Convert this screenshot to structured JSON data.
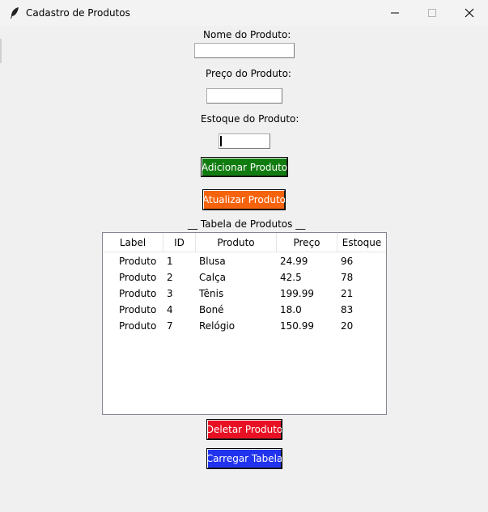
{
  "window": {
    "title": "Cadastro de Produtos"
  },
  "form": {
    "nome_label": "Nome do Produto:",
    "nome_value": "",
    "preco_label": "Preço do Produto:",
    "preco_value": "",
    "estoque_label": "Estoque do Produto:",
    "estoque_value": ""
  },
  "buttons": {
    "adicionar": "Adicionar Produto",
    "atualizar": "Atualizar Produto",
    "deletar": "Deletar Produto",
    "carregar": "Carregar Tabela"
  },
  "colors": {
    "adicionar": "#107c10",
    "atualizar": "#f7630c",
    "deletar": "#e81123",
    "carregar": "#2233ee"
  },
  "table": {
    "title": "__ Tabela de Produtos __",
    "columns": [
      "Label",
      "ID",
      "Produto",
      "Preço",
      "Estoque"
    ],
    "rows": [
      [
        "Produto",
        "1",
        "Blusa",
        "24.99",
        "96"
      ],
      [
        "Produto",
        "2",
        "Calça",
        "42.5",
        "78"
      ],
      [
        "Produto",
        "3",
        "Tênis",
        "199.99",
        "21"
      ],
      [
        "Produto",
        "4",
        "Boné",
        "18.0",
        "83"
      ],
      [
        "Produto",
        "7",
        "Relógio",
        "150.99",
        "20"
      ]
    ]
  }
}
